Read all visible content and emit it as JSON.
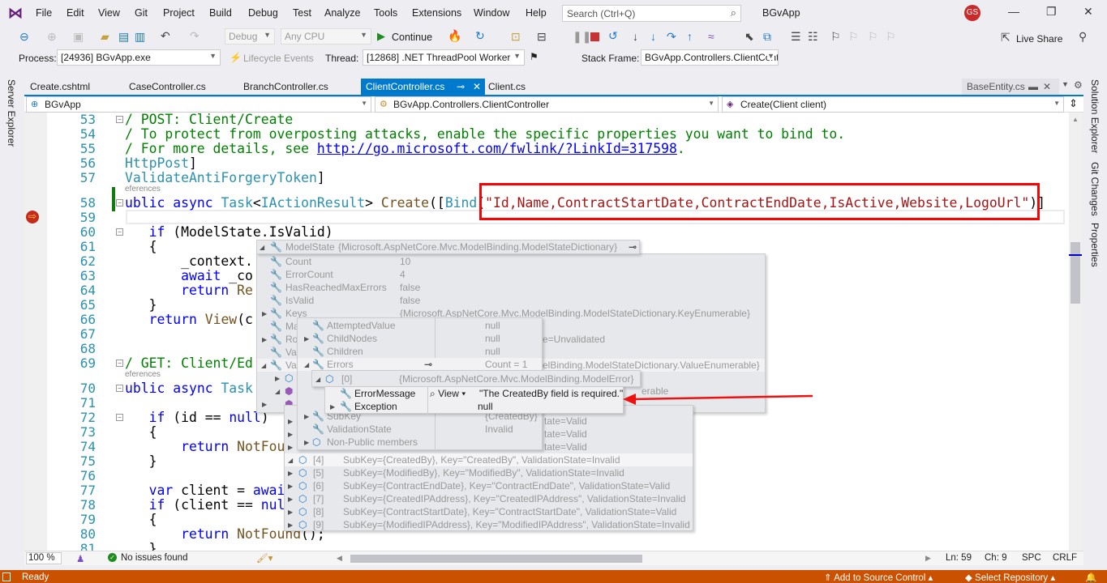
{
  "app": {
    "title": "BGvApp",
    "user_initials": "GS",
    "search_placeholder": "Search (Ctrl+Q)"
  },
  "menu": [
    "File",
    "Edit",
    "View",
    "Git",
    "Project",
    "Build",
    "Debug",
    "Test",
    "Analyze",
    "Tools",
    "Extensions",
    "Window",
    "Help"
  ],
  "toolbar": {
    "config": "Debug",
    "platform": "Any CPU",
    "continue": "Continue",
    "live_share": "Live Share"
  },
  "debug_location": {
    "process_label": "Process:",
    "process": "[24936] BGvApp.exe",
    "lifecycle": "Lifecycle Events",
    "thread_label": "Thread:",
    "thread": "[12868] .NET ThreadPool Worker",
    "stack_label": "Stack Frame:",
    "stack": "BGvApp.Controllers.ClientController.Creat"
  },
  "side_left": [
    "Server Explorer"
  ],
  "side_right": [
    "Solution Explorer",
    "Git Changes",
    "Properties"
  ],
  "tabs": [
    {
      "label": "Create.cshtml"
    },
    {
      "label": "CaseController.cs"
    },
    {
      "label": "BranchController.cs"
    },
    {
      "label": "ClientController.cs",
      "active": true
    },
    {
      "label": "Client.cs"
    }
  ],
  "preview_tab": "BaseEntity.cs",
  "nav": {
    "project": "BGvApp",
    "class": "BGvApp.Controllers.ClientController",
    "member": "Create(Client client)"
  },
  "code_lines": [
    {
      "n": "53",
      "tokens": [
        [
          "c",
          "/ POST: Client/Create"
        ]
      ]
    },
    {
      "n": "54",
      "tokens": [
        [
          "c",
          "/ To protect from overposting attacks, enable the specific properties you want to bind to."
        ]
      ]
    },
    {
      "n": "55",
      "tokens": [
        [
          "c",
          "/ For more details, see "
        ],
        [
          "link",
          "http://go.microsoft.com/fwlink/?LinkId=317598"
        ],
        [
          "c",
          "."
        ]
      ]
    },
    {
      "n": "56",
      "tokens": [
        [
          "t",
          "HttpPost"
        ],
        [
          "p",
          "]"
        ]
      ]
    },
    {
      "n": "57",
      "tokens": [
        [
          "t",
          "ValidateAntiForgeryToken"
        ],
        [
          "p",
          "]"
        ]
      ]
    },
    {
      "n": "58",
      "lens": "eferences",
      "tokens": [
        [
          "k",
          "ublic"
        ],
        [
          "p",
          " "
        ],
        [
          "k",
          "async"
        ],
        [
          "p",
          " "
        ],
        [
          "t",
          "Task"
        ],
        [
          "p",
          "<"
        ],
        [
          "t",
          "IActionResult"
        ],
        [
          "p",
          "> "
        ],
        [
          "m",
          "Create"
        ],
        [
          "p",
          "(["
        ],
        [
          "t",
          "Bind"
        ],
        [
          "p",
          "("
        ],
        [
          "s",
          "\"Id,Name,ContractStartDate,ContractEndDate,IsActive,Website,LogoUrl\""
        ],
        [
          "p",
          ")]"
        ]
      ]
    },
    {
      "n": "59",
      "tokens": []
    },
    {
      "n": "60",
      "tokens": [
        [
          "p",
          "   "
        ],
        [
          "k",
          "if"
        ],
        [
          "p",
          " (ModelState.IsValid)"
        ]
      ]
    },
    {
      "n": "61",
      "tokens": [
        [
          "p",
          "   {"
        ]
      ]
    },
    {
      "n": "62",
      "tokens": [
        [
          "p",
          "       _context."
        ]
      ]
    },
    {
      "n": "63",
      "tokens": [
        [
          "p",
          "       "
        ],
        [
          "k",
          "await"
        ],
        [
          "p",
          " _co"
        ]
      ]
    },
    {
      "n": "64",
      "tokens": [
        [
          "p",
          "       "
        ],
        [
          "k",
          "return"
        ],
        [
          "p",
          " "
        ],
        [
          "m",
          "Re"
        ]
      ]
    },
    {
      "n": "65",
      "tokens": [
        [
          "p",
          "   }"
        ]
      ]
    },
    {
      "n": "66",
      "tokens": [
        [
          "p",
          "   "
        ],
        [
          "k",
          "return"
        ],
        [
          "p",
          " "
        ],
        [
          "m",
          "View"
        ],
        [
          "p",
          "(c"
        ]
      ]
    },
    {
      "n": "67",
      "tokens": []
    },
    {
      "n": "68",
      "tokens": []
    },
    {
      "n": "69",
      "tokens": [
        [
          "c",
          "/ GET: Client/Ed"
        ]
      ]
    },
    {
      "n": "70",
      "lens": "eferences",
      "tokens": [
        [
          "k",
          "ublic"
        ],
        [
          "p",
          " "
        ],
        [
          "k",
          "async"
        ],
        [
          "p",
          " "
        ],
        [
          "t",
          "Task"
        ]
      ]
    },
    {
      "n": "71",
      "tokens": []
    },
    {
      "n": "72",
      "tokens": [
        [
          "p",
          "   "
        ],
        [
          "k",
          "if"
        ],
        [
          "p",
          " (id == "
        ],
        [
          "k",
          "null"
        ],
        [
          "p",
          ")"
        ]
      ]
    },
    {
      "n": "73",
      "tokens": [
        [
          "p",
          "   {"
        ]
      ]
    },
    {
      "n": "74",
      "tokens": [
        [
          "p",
          "       "
        ],
        [
          "k",
          "return"
        ],
        [
          "p",
          " "
        ],
        [
          "m",
          "NotFound"
        ],
        [
          "p",
          "();"
        ]
      ]
    },
    {
      "n": "75",
      "tokens": [
        [
          "p",
          "   }"
        ]
      ]
    },
    {
      "n": "76",
      "tokens": []
    },
    {
      "n": "77",
      "tokens": [
        [
          "p",
          "   "
        ],
        [
          "k",
          "var"
        ],
        [
          "p",
          " client = "
        ],
        [
          "k",
          "await"
        ]
      ]
    },
    {
      "n": "78",
      "tokens": [
        [
          "p",
          "   "
        ],
        [
          "k",
          "if"
        ],
        [
          "p",
          " (client == "
        ],
        [
          "k",
          "null"
        ],
        [
          "p",
          ")"
        ]
      ]
    },
    {
      "n": "79",
      "tokens": [
        [
          "p",
          "   {"
        ]
      ]
    },
    {
      "n": "80",
      "tokens": [
        [
          "p",
          "       "
        ],
        [
          "k",
          "return"
        ],
        [
          "p",
          " "
        ],
        [
          "m",
          "NotFound"
        ],
        [
          "p",
          "();"
        ]
      ]
    },
    {
      "n": "81",
      "tokens": [
        [
          "p",
          "   }"
        ]
      ]
    }
  ],
  "datatip": {
    "root": {
      "name": "ModelState",
      "value": "{Microsoft.AspNetCore.Mvc.ModelBinding.ModelStateDictionary}"
    },
    "props": [
      {
        "name": "Count",
        "value": "10"
      },
      {
        "name": "ErrorCount",
        "value": "4"
      },
      {
        "name": "HasReachedMaxErrors",
        "value": "false"
      },
      {
        "name": "IsValid",
        "value": "false"
      },
      {
        "name": "Keys",
        "value": "{Microsoft.AspNetCore.Mvc.ModelBinding.ModelStateDictionary.KeyEnumerable}"
      },
      {
        "name": "Ma",
        "value": ""
      },
      {
        "name": "Ro",
        "value": "e=Unvalidated"
      },
      {
        "name": "Val",
        "value": ""
      },
      {
        "name": "Val",
        "value": "elBinding.ModelStateDictionary.ValueEnumerable}"
      }
    ],
    "hidden_tail": "erable",
    "entry": [
      {
        "name": "AttemptedValue",
        "value": "null"
      },
      {
        "name": "ChildNodes",
        "value": "null"
      },
      {
        "name": "Children",
        "value": "null"
      },
      {
        "name": "Errors",
        "value": "Count = 1"
      }
    ],
    "entry_tail": [
      {
        "name": "SubKey",
        "value": "{CreatedBy}"
      },
      {
        "name": "ValidationState",
        "value": "Invalid"
      },
      {
        "name": "Non-Public members",
        "value": ""
      }
    ],
    "error": {
      "name": "[0]",
      "value": "{Microsoft.AspNetCore.Mvc.ModelBinding.ModelError}"
    },
    "error_props": [
      {
        "name": "ErrorMessage",
        "view": "View",
        "value": "\"The CreatedBy field is required.\""
      },
      {
        "name": "Exception",
        "value": "null"
      }
    ],
    "values_partial": [
      "tate=Valid",
      "tate=Valid",
      "tate=Valid"
    ],
    "values": [
      {
        "index": "[4]",
        "value": "SubKey={CreatedBy}, Key=\"CreatedBy\", ValidationState=Invalid"
      },
      {
        "index": "[5]",
        "value": "SubKey={ModifiedBy}, Key=\"ModifiedBy\", ValidationState=Invalid"
      },
      {
        "index": "[6]",
        "value": "SubKey={ContractEndDate}, Key=\"ContractEndDate\", ValidationState=Valid"
      },
      {
        "index": "[7]",
        "value": "SubKey={CreatedIPAddress}, Key=\"CreatedIPAddress\", ValidationState=Invalid"
      },
      {
        "index": "[8]",
        "value": "SubKey={ContractStartDate}, Key=\"ContractStartDate\", ValidationState=Valid"
      },
      {
        "index": "[9]",
        "value": "SubKey={ModifiedIPAddress}, Key=\"ModifiedIPAddress\", ValidationState=Invalid"
      }
    ]
  },
  "editor_status": {
    "zoom": "100 %",
    "issues": "No issues found",
    "ln": "Ln: 59",
    "ch": "Ch: 9",
    "spc": "SPC",
    "crlf": "CRLF"
  },
  "status": {
    "ready": "Ready",
    "add_source": "Add to Source Control",
    "select_repo": "Select Repository"
  },
  "colors": {
    "accent": "#007acc",
    "status_bar": "#ca5100",
    "annotation": "#ff0000"
  }
}
